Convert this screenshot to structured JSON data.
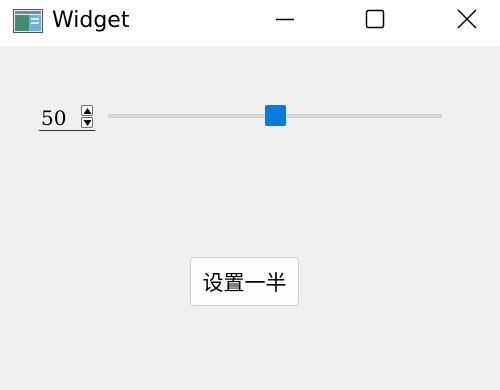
{
  "window": {
    "title": "Widget",
    "icon": "qt-widget-app-icon"
  },
  "controls": {
    "minimize_icon": "minimize-icon",
    "maximize_icon": "maximize-icon",
    "close_icon": "close-icon"
  },
  "spinbox": {
    "value": "50",
    "up_icon": "spin-up-icon",
    "down_icon": "spin-down-icon"
  },
  "slider": {
    "value": 50,
    "min": 0,
    "max": 100,
    "accent_color": "#0a7bdc"
  },
  "button": {
    "label": "设置一半"
  }
}
